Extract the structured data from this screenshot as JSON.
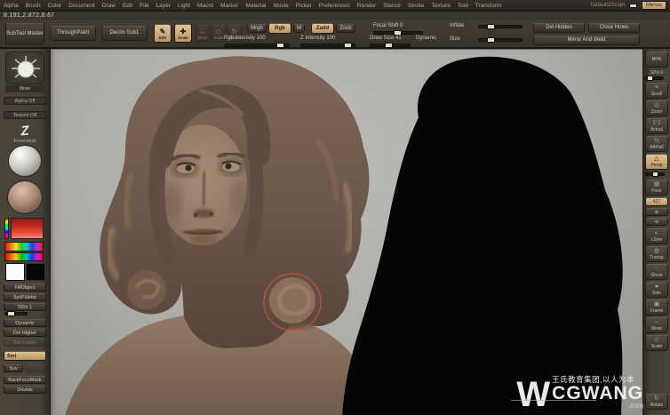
{
  "menu": {
    "items": [
      "Alpha",
      "Brush",
      "Color",
      "Document",
      "Draw",
      "Edit",
      "File",
      "Layer",
      "Light",
      "Macro",
      "Marker",
      "Material",
      "Movie",
      "Picker",
      "Preferences",
      "Render",
      "Stencil",
      "Stroke",
      "Texture",
      "Tool",
      "Transform"
    ],
    "right": {
      "script_label": "DefaultZScript",
      "menus_button": "Menus"
    }
  },
  "window": {
    "coords_readout": "8.191,2.872,8.67"
  },
  "shelf": {
    "subtool_master": "SubTool Master",
    "plugin2": "ThroughPaint",
    "plugin3": "Decim Sub1",
    "edit": "Edit",
    "draw": "Draw",
    "move": "Move",
    "scale": "Scale",
    "rotate": "Rotate",
    "mrgb": "Mrgb",
    "rgb": "Rgb",
    "m": "M",
    "zadd": "Zadd",
    "zsub": "Zsub",
    "focal_shift": "Focal Shift 0",
    "rgb_intensity": "Rgb Intensity 100",
    "z_intensity": "Z Intensity 100",
    "draw_size": "Draw Size 41",
    "dynamic": "Dynamic",
    "inflate": "Inflate",
    "size": "Size",
    "del_hidden": "Del Hidden",
    "close_holes": "Close Holes",
    "mirror_weld": "Mirror And Weld",
    "glyphs": {
      "edit": "✎",
      "draw": "✚",
      "move": "↔",
      "scale": "◇",
      "rotate": "↻"
    }
  },
  "tray": {
    "brush_label": "Move",
    "alpha_label": "Alpha Off",
    "texture_label": "Texture Off",
    "stroke_glyph": "Z",
    "stroke_label": "FreeHand",
    "fill_object": "FillObject",
    "sys_palette": "SysPalette",
    "sdiv": "SDiv 1",
    "dynamic": "Dynamic",
    "del_higher": "Del Higher",
    "del_lower": "Del Lower",
    "smt": "Smt",
    "suv": "Suv",
    "backfacemask": "BackFaceMask",
    "double": "Double"
  },
  "right_shelf": {
    "bpr": "BPR",
    "spix": "SPix 0",
    "scroll": "Scroll",
    "zoom": "Zoom",
    "actual": "Actual",
    "aahalf": "AAHalf",
    "persp": "Persp",
    "floor": "Floor",
    "value_chip": "417",
    "zoom_in": "⊕",
    "zoom_out": "⊖",
    "lsym": "LSym",
    "transp": "Transp",
    "ghost": "Ghost",
    "solo": "Solo",
    "frame": "Frame",
    "move": "Move",
    "scale": "Scale",
    "rotate": "Rotate"
  },
  "watermark": {
    "logo": "W",
    "cn": "王氏教育集团,以人为本",
    "brand": "CGWANG",
    "tld": ".com"
  },
  "colors": {
    "accent_tan": "#c9a06c",
    "clay": "#8a7160",
    "silhouette": "#050505",
    "cursor_red": "#c0564a",
    "canvas_bg": "#b0aea9"
  }
}
